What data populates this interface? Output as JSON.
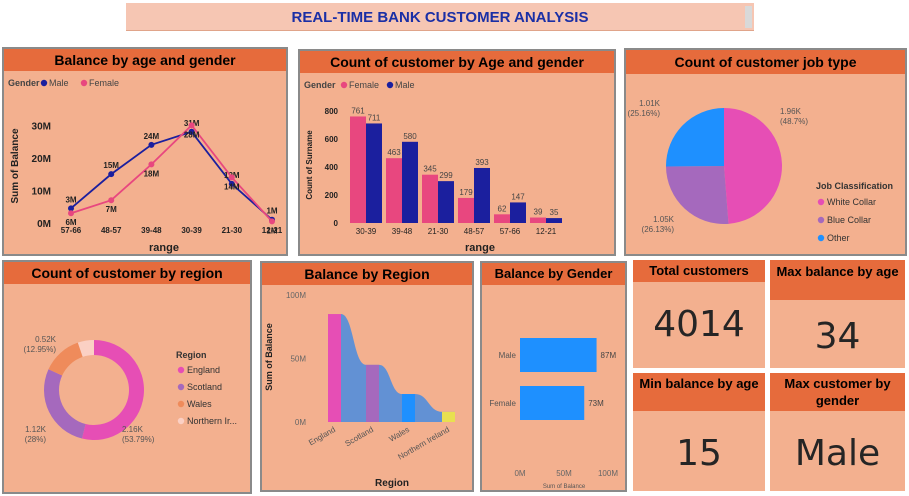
{
  "header": {
    "title": "REAL-TIME BANK CUSTOMER ANALYSIS"
  },
  "colors": {
    "male": "#1b1f9e",
    "female": "#e8477f",
    "panel_bg": "#f3b08f",
    "header_bg": "#e66b3c",
    "accent_blue": "#1e90ff",
    "pink": "#e64eb5",
    "purple": "#a569bd",
    "orange": "#ef8b5b",
    "light": "#fbd0c4"
  },
  "panels": {
    "balance_age_gender": "Balance by age and gender",
    "count_age_gender": "Count of customer by Age and gender",
    "job_type": "Count of customer job type",
    "region": "Count of customer by region",
    "balance_region": "Balance by Region",
    "balance_gender": "Balance by Gender"
  },
  "kpis": {
    "total_customers": {
      "label": "Total customers",
      "value": "4014"
    },
    "max_balance_age": {
      "label": "Max balance by age",
      "value": "34"
    },
    "min_balance_age": {
      "label": "Min balance by age",
      "value": "15"
    },
    "max_customer_gender": {
      "label": "Max customer by gender",
      "value": "Male"
    }
  },
  "chart_data": [
    {
      "type": "line",
      "title": "Balance by age and gender",
      "legend_title": "Gender",
      "xlabel": "range",
      "ylabel": "Sum of Balance",
      "categories": [
        "57-66",
        "48-57",
        "39-48",
        "30-39",
        "21-30",
        "12-21"
      ],
      "y_ticks": [
        "0M",
        "10M",
        "20M",
        "30M"
      ],
      "ylim": [
        0,
        35
      ],
      "series": [
        {
          "name": "Male",
          "values": [
            4.5,
            15,
            24,
            28,
            12,
            1
          ],
          "labels": [
            "3M",
            "15M",
            "24M",
            "31M",
            "12M",
            "1M"
          ]
        },
        {
          "name": "Female",
          "values": [
            3,
            7,
            18,
            30,
            14,
            0.5
          ],
          "labels": [
            "6M",
            "7M",
            "18M",
            "28M",
            "14M",
            "1M"
          ]
        }
      ]
    },
    {
      "type": "bar",
      "title": "Count of customer by Age and gender",
      "legend_title": "Gender",
      "xlabel": "range",
      "ylabel": "Count of Surname",
      "categories": [
        "30-39",
        "39-48",
        "21-30",
        "48-57",
        "57-66",
        "12-21"
      ],
      "y_ticks": [
        "0",
        "200",
        "400",
        "600",
        "800"
      ],
      "ylim": [
        0,
        800
      ],
      "series": [
        {
          "name": "Female",
          "values": [
            761,
            463,
            345,
            179,
            62,
            39
          ]
        },
        {
          "name": "Male",
          "values": [
            711,
            580,
            299,
            393,
            147,
            35
          ]
        }
      ]
    },
    {
      "type": "pie",
      "title": "Count of customer job type",
      "legend_title": "Job Classification",
      "categories": [
        "White Collar",
        "Blue Collar",
        "Other"
      ],
      "values": [
        1960,
        1050,
        1010
      ],
      "labels": [
        "1.96K\n(48.7%)",
        "1.05K\n(26.13%)",
        "1.01K\n(25.16%)"
      ]
    },
    {
      "type": "pie",
      "title": "Count of customer by region",
      "legend_title": "Region",
      "categories": [
        "England",
        "Scotland",
        "Wales",
        "Northern Ir..."
      ],
      "values": [
        2160,
        1120,
        520,
        210
      ],
      "labels": [
        "2.16K\n(53.79%)",
        "1.12K\n(28%)",
        "0.52K\n(12.95%)",
        ""
      ]
    },
    {
      "type": "area",
      "title": "Balance by Region",
      "xlabel": "Region",
      "ylabel": "Sum of Balance",
      "categories": [
        "England",
        "Scotland",
        "Wales",
        "Northern Ireland"
      ],
      "values": [
        85,
        45,
        22,
        8
      ],
      "y_ticks": [
        "0M",
        "50M",
        "100M"
      ],
      "ylim": [
        0,
        100
      ]
    },
    {
      "type": "bar",
      "title": "Balance by Gender",
      "xlabel": "Sum of Balance",
      "categories": [
        "Male",
        "Female"
      ],
      "values": [
        87,
        73
      ],
      "labels": [
        "87M",
        "73M"
      ],
      "x_ticks": [
        "0M",
        "50M",
        "100M"
      ],
      "xlim": [
        0,
        100
      ]
    }
  ]
}
